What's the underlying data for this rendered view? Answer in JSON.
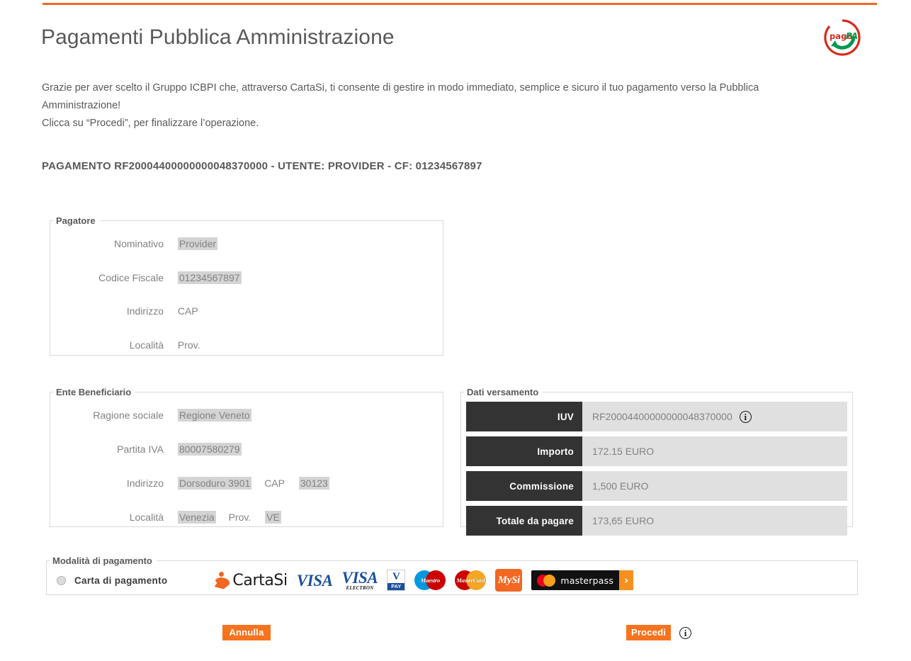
{
  "header": {
    "title": "Pagamenti Pubblica Amministrazione",
    "logo_name": "pagopa-logo",
    "logo_text_primary": "pago",
    "logo_text_secondary": "PA",
    "accent_color": "#f26722"
  },
  "intro": {
    "line1": "Grazie per aver scelto il Gruppo ICBPI che, attraverso CartaSi, ti consente di gestire in modo immediato, semplice e sicuro il tuo pagamento verso la Pubblica Amministrazione!",
    "line2": "Clicca su “Procedi”, per finalizzare l’operazione."
  },
  "payment_header": "PAGAMENTO RF20004400000000048370000 - UTENTE: PROVIDER - CF: 01234567897",
  "pagatore": {
    "legend": "Pagatore",
    "rows": [
      {
        "label": "Nominativo",
        "value": "Provider",
        "highlight": true
      },
      {
        "label": "Codice Fiscale",
        "value": "01234567897",
        "highlight": true
      },
      {
        "label": "Indirizzo",
        "value": "CAP",
        "highlight": false
      },
      {
        "label": "Località",
        "value": "Prov.",
        "highlight": false
      }
    ]
  },
  "ente": {
    "legend": "Ente Beneficiario",
    "rows": [
      {
        "label": "Ragione sociale",
        "value": "Regione Veneto"
      },
      {
        "label": "Partita IVA",
        "value": "80007580279"
      },
      {
        "label": "Indirizzo",
        "value": "Dorsoduro 3901",
        "extra_label": "CAP",
        "extra_value": "30123"
      },
      {
        "label": "Località",
        "value": "Venezia",
        "extra_label": "Prov.",
        "extra_value": "VE"
      }
    ]
  },
  "dati_versamento": {
    "legend": "Dati versamento",
    "rows": [
      {
        "key": "IUV",
        "value": "RF20004400000000048370000",
        "info": true
      },
      {
        "key": "Importo",
        "value": "172.15 EURO",
        "info": false
      },
      {
        "key": "Commissione",
        "value": "1,500 EURO",
        "info": false
      },
      {
        "key": "Totale da pagare",
        "value": "173,65 EURO",
        "info": false
      }
    ]
  },
  "modalita": {
    "legend": "Modalità di pagamento",
    "option_label": "Carta di pagamento",
    "option_selected": false,
    "logos": [
      {
        "name": "cartasi-logo",
        "text": "CartaSi"
      },
      {
        "name": "visa-logo",
        "text": "VISA"
      },
      {
        "name": "visa-electron-logo",
        "text": "VISA",
        "sub": "ELECTRON"
      },
      {
        "name": "vpay-logo",
        "text": "V",
        "sub": "PAY"
      },
      {
        "name": "maestro-logo",
        "text": "Maestro"
      },
      {
        "name": "mastercard-logo",
        "text": "MasterCard"
      },
      {
        "name": "mysi-logo",
        "text": "MySi"
      },
      {
        "name": "masterpass-logo",
        "text": "masterpass"
      }
    ]
  },
  "buttons": {
    "cancel": "Annulla",
    "proceed": "Procedi",
    "button_color": "#f7731e"
  },
  "icons": {
    "info": "i"
  }
}
